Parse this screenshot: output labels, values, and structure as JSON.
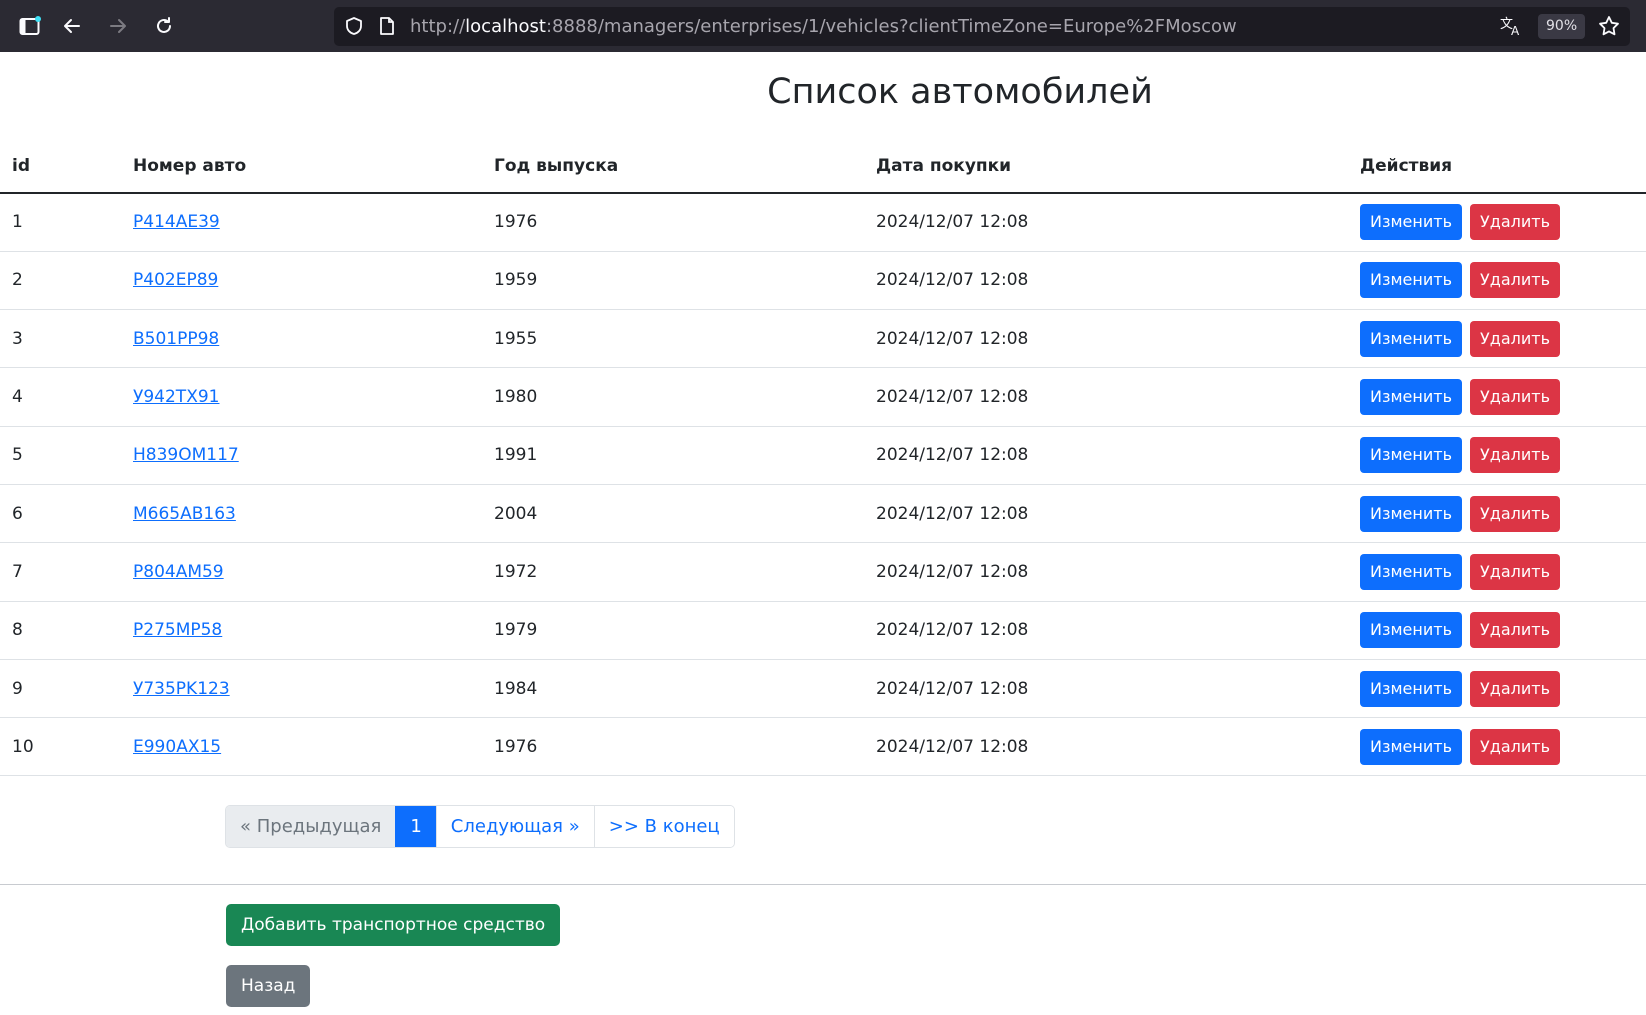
{
  "browser": {
    "url_prefix": "http://",
    "url_host": "localhost",
    "url_rest": ":8888/managers/enterprises/1/vehicles?clientTimeZone=Europe%2FMoscow",
    "zoom": "90%"
  },
  "page": {
    "title": "Список автомобилей"
  },
  "table": {
    "headers": {
      "id": "id",
      "plate": "Номер авто",
      "year": "Год выпуска",
      "date": "Дата покупки",
      "actions": "Действия"
    },
    "edit_label": "Изменить",
    "delete_label": "Удалить",
    "rows": [
      {
        "id": "1",
        "plate": "P414AE39",
        "year": "1976",
        "date": "2024/12/07 12:08"
      },
      {
        "id": "2",
        "plate": "P402EP89",
        "year": "1959",
        "date": "2024/12/07 12:08"
      },
      {
        "id": "3",
        "plate": "B501PP98",
        "year": "1955",
        "date": "2024/12/07 12:08"
      },
      {
        "id": "4",
        "plate": "У942TX91",
        "year": "1980",
        "date": "2024/12/07 12:08"
      },
      {
        "id": "5",
        "plate": "H839OM117",
        "year": "1991",
        "date": "2024/12/07 12:08"
      },
      {
        "id": "6",
        "plate": "M665AB163",
        "year": "2004",
        "date": "2024/12/07 12:08"
      },
      {
        "id": "7",
        "plate": "P804AM59",
        "year": "1972",
        "date": "2024/12/07 12:08"
      },
      {
        "id": "8",
        "plate": "P275MP58",
        "year": "1979",
        "date": "2024/12/07 12:08"
      },
      {
        "id": "9",
        "plate": "У735PK123",
        "year": "1984",
        "date": "2024/12/07 12:08"
      },
      {
        "id": "10",
        "plate": "E990AX15",
        "year": "1976",
        "date": "2024/12/07 12:08"
      }
    ]
  },
  "pagination": {
    "prev": "« Предыдущая",
    "current": "1",
    "next": "Следующая »",
    "last": ">> В конец"
  },
  "actions": {
    "add": "Добавить транспортное средство",
    "back": "Назад"
  },
  "colors": {
    "primary": "#0d6efd",
    "danger": "#dc3545",
    "success": "#198754",
    "secondary": "#6c757d"
  }
}
